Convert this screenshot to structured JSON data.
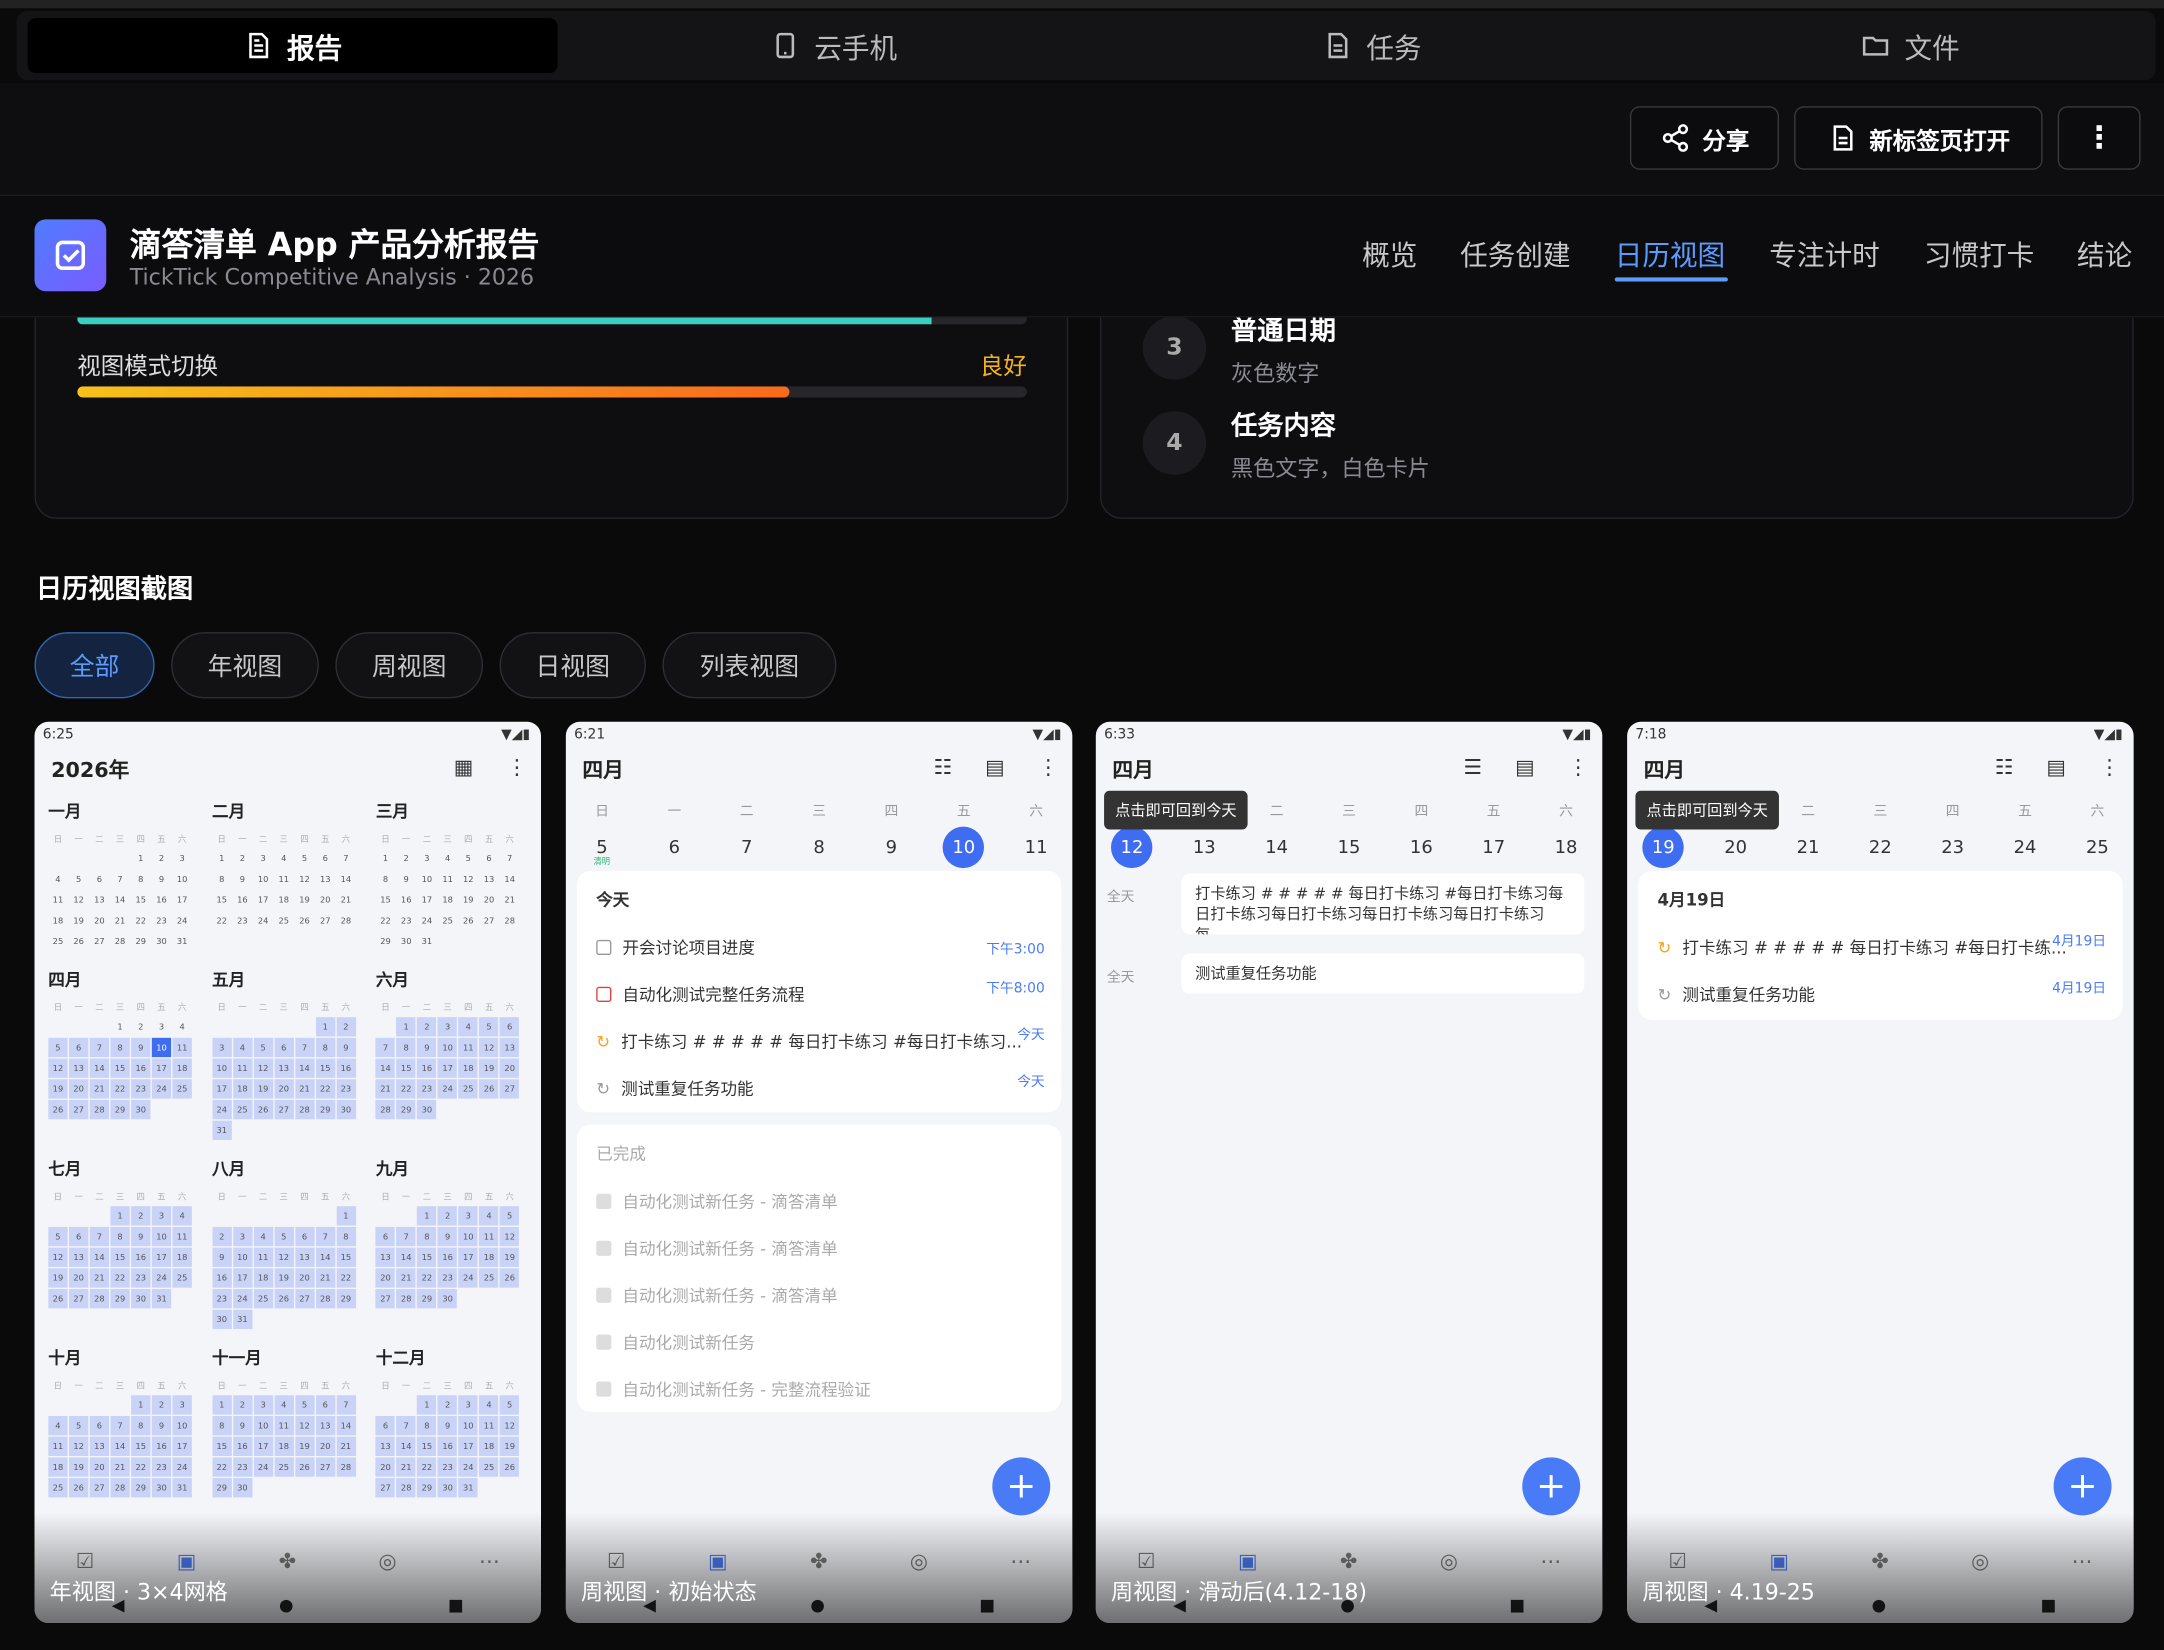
{
  "tabs": {
    "report": "报告",
    "phone": "云手机",
    "tasks": "任务",
    "files": "文件"
  },
  "toolbar": {
    "share": "分享",
    "newtab": "新标签页打开",
    "more": "⋮"
  },
  "header": {
    "title": "滴答清单 App 产品分析报告",
    "subtitle": "TickTick Competitive Analysis · 2026",
    "nav": [
      "概览",
      "任务创建",
      "日历视图",
      "专注计时",
      "习惯打卡",
      "结论"
    ]
  },
  "left_card": {
    "bar_label": "视图模式切换",
    "bar_rating": "良好",
    "bar_value_pct": 75
  },
  "right_card": {
    "steps": [
      {
        "num": "3",
        "title": "普通日期",
        "desc": "灰色数字"
      },
      {
        "num": "4",
        "title": "任务内容",
        "desc": "黑色文字，白色卡片"
      }
    ]
  },
  "section": {
    "title": "日历视图截图",
    "filters": [
      "全部",
      "年视图",
      "周视图",
      "日视图",
      "列表视图"
    ]
  },
  "phone_common": {
    "weekdays": [
      "日",
      "一",
      "二",
      "三",
      "四",
      "五",
      "六"
    ],
    "month_label": "四月"
  },
  "phone1": {
    "time": "6:25",
    "year": "2026年",
    "caption": "年视图 · 3×4网格",
    "months": [
      "一月",
      "二月",
      "三月",
      "四月",
      "五月",
      "六月",
      "七月",
      "八月",
      "九月",
      "十月",
      "十一月",
      "十二月"
    ]
  },
  "phone2": {
    "time": "6:21",
    "caption": "周视图 · 初始状态",
    "days": [
      "5",
      "6",
      "7",
      "8",
      "9",
      "10",
      "11"
    ],
    "holiday": "清明",
    "today_label": "今天",
    "tasks": [
      {
        "t": "开会讨论项目进度",
        "r": "下午3:00"
      },
      {
        "t": "自动化测试完整任务流程",
        "r": "下午8:00"
      },
      {
        "t": "打卡练习 # # # # # 每日打卡练习 #每日打卡练习...",
        "r": "今天"
      },
      {
        "t": "测试重复任务功能",
        "r": "今天"
      }
    ],
    "done_label": "已完成",
    "done": [
      "自动化测试新任务 - 滴答清单",
      "自动化测试新任务 - 滴答清单",
      "自动化测试新任务 - 滴答清单",
      "自动化测试新任务",
      "自动化测试新任务 - 完整流程验证"
    ]
  },
  "phone3": {
    "time": "6:33",
    "caption": "周视图 · 滑动后(4.12-18)",
    "days": [
      "12",
      "13",
      "14",
      "15",
      "16",
      "17",
      "18"
    ],
    "tooltip": "点击即可回到今天",
    "allday": "全天",
    "events": [
      "打卡练习 # # # # # 每日打卡练习 #每日打卡练习每日打卡练习每日打卡练习每日打卡练习每日打卡练习每...",
      "测试重复任务功能"
    ]
  },
  "phone4": {
    "time": "7:18",
    "caption": "周视图 · 4.19-25",
    "days": [
      "19",
      "20",
      "21",
      "22",
      "23",
      "24",
      "25"
    ],
    "tooltip": "点击即可回到今天",
    "date_label": "4月19日",
    "tasks": [
      {
        "t": "打卡练习 # # # # # 每日打卡练习 #每日打卡练...",
        "r": "4月19日"
      },
      {
        "t": "测试重复任务功能",
        "r": "4月19日"
      }
    ]
  }
}
